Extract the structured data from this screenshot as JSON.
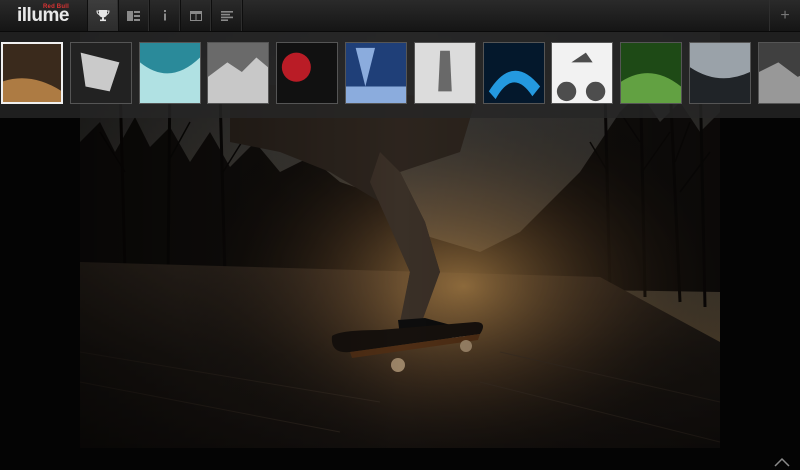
{
  "app": {
    "brand_small": "Red Bull",
    "logo_text": "illume"
  },
  "nav": {
    "items": [
      {
        "name": "trophy",
        "icon": "trophy-icon",
        "active": true
      },
      {
        "name": "gallery",
        "icon": "gallery-icon",
        "active": false
      },
      {
        "name": "info",
        "icon": "info-icon",
        "active": false
      },
      {
        "name": "grid",
        "icon": "grid-icon",
        "active": false
      },
      {
        "name": "text",
        "icon": "list-icon",
        "active": false
      }
    ],
    "plus_label": "+"
  },
  "thumbnails": {
    "selected_index": 0,
    "items": [
      {
        "subject": "skateboarder at sunset",
        "palette": [
          "#3a2a1c",
          "#c28a4a"
        ]
      },
      {
        "subject": "bmx rider black and white",
        "palette": [
          "#222222",
          "#e8e8e8"
        ]
      },
      {
        "subject": "surfer in teal water",
        "palette": [
          "#2a8a9a",
          "#c8f0f0"
        ]
      },
      {
        "subject": "mountain landscape black and white",
        "palette": [
          "#6a6a6a",
          "#d8d8d8"
        ]
      },
      {
        "subject": "skydiver with red accents",
        "palette": [
          "#111111",
          "#d81e2a"
        ]
      },
      {
        "subject": "blue snow scene",
        "palette": [
          "#1f3f78",
          "#9fc0ef"
        ]
      },
      {
        "subject": "figure against white",
        "palette": [
          "#dcdcdc",
          "#555555"
        ]
      },
      {
        "subject": "neon blue motocross",
        "palette": [
          "#04182c",
          "#2ab0ff"
        ]
      },
      {
        "subject": "mountain biker sketch",
        "palette": [
          "#f2f2f2",
          "#303030"
        ]
      },
      {
        "subject": "green action scene",
        "palette": [
          "#1e4a16",
          "#6fb04a"
        ]
      },
      {
        "subject": "snow powder skier",
        "palette": [
          "#202428",
          "#b0b8c0"
        ]
      },
      {
        "subject": "grey rock climb",
        "palette": [
          "#404040",
          "#a8a8a8"
        ]
      }
    ]
  },
  "main_photo": {
    "subject": "skateboarder carving down an asphalt road at sunset",
    "colors": {
      "sky_top": "#4a4a4c",
      "sky_glow": "#c99a5a",
      "road": "#2a2420",
      "trees": "#151210"
    }
  }
}
